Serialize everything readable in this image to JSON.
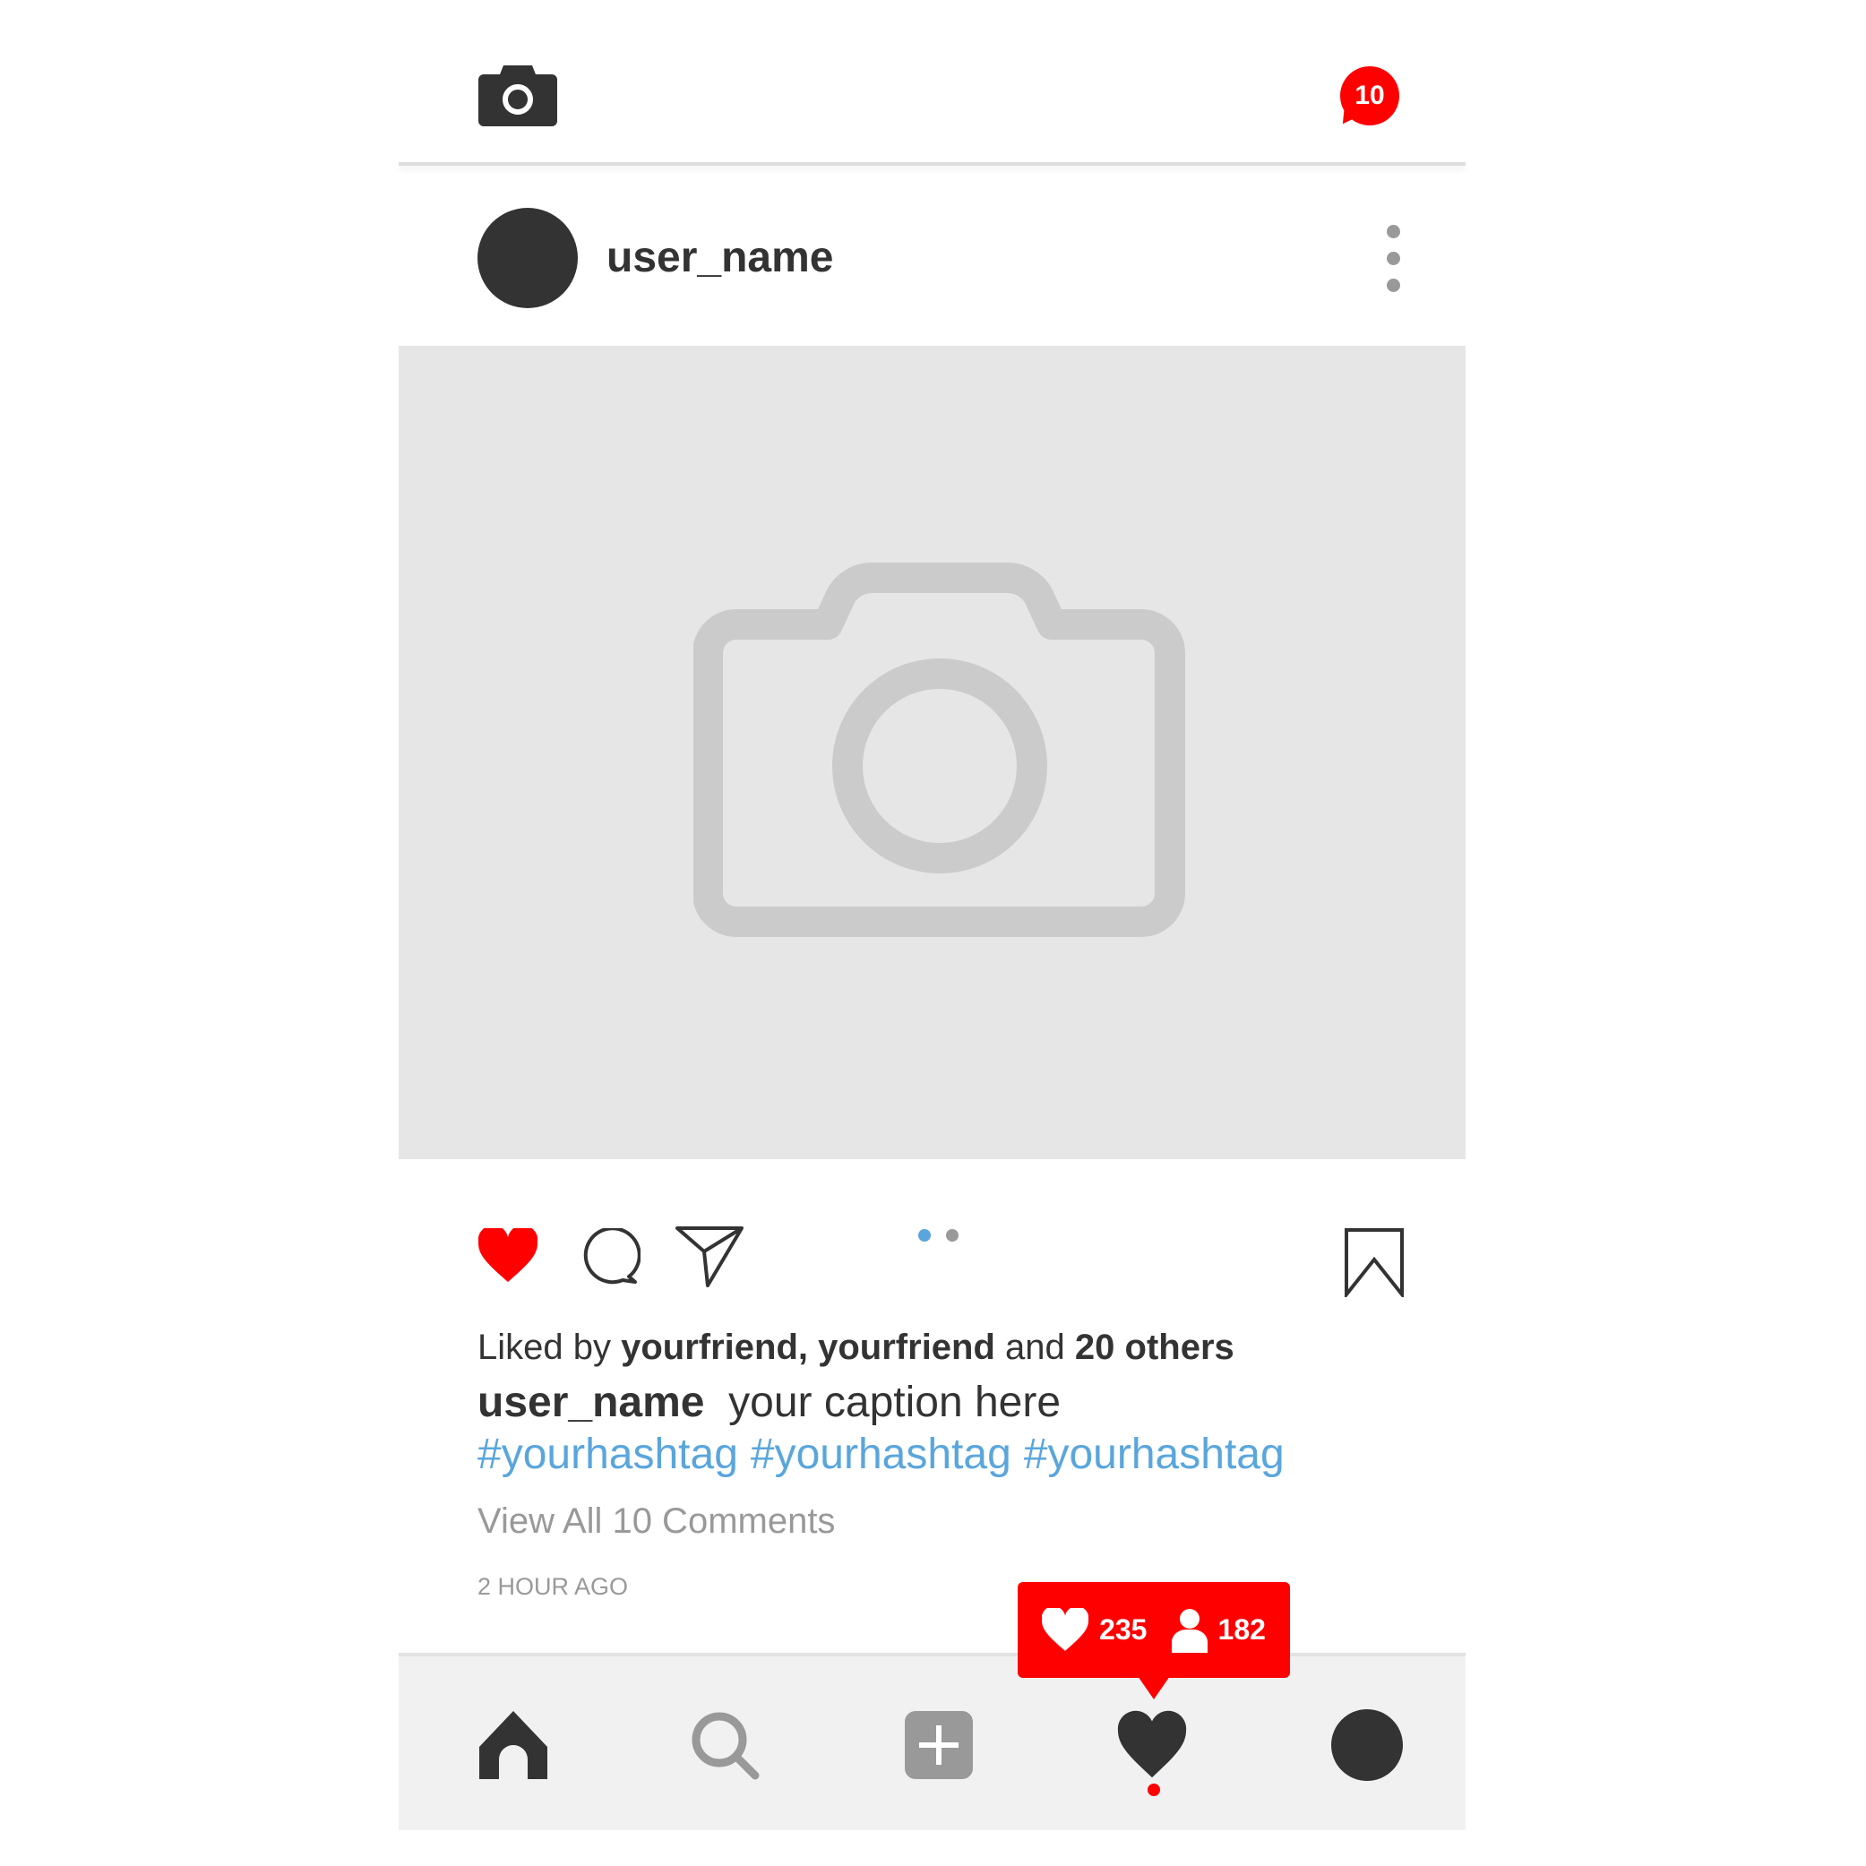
{
  "header": {
    "notification_count": "10",
    "icons": [
      "camera-icon",
      "notification-badge"
    ]
  },
  "post": {
    "username": "user_name",
    "more_icon": "vertical-dots-icon",
    "image_placeholder_icon": "camera-icon",
    "carousel": {
      "count": 2,
      "active": 1,
      "active_color": "#5aa6dc"
    },
    "actions": [
      "heart-icon",
      "comment-icon",
      "send-icon",
      "bookmark-icon"
    ],
    "liked_prefix": "Liked by",
    "liked_names": "yourfriend, yourfriend",
    "liked_and": "and",
    "liked_others": "20 others",
    "caption_user": "user_name",
    "caption": "your caption here",
    "hashtags": [
      "#yourhashtag",
      "#yourhashtag",
      "#yourhashtag"
    ],
    "view_comments": "View All 10 Comments",
    "timestamp": "2 HOUR AGO"
  },
  "activity_popup": {
    "likes": "235",
    "followers": "182"
  },
  "bottom_nav": [
    "home-icon",
    "search-icon",
    "add-icon",
    "activity-heart-icon",
    "profile-icon"
  ],
  "colors": {
    "accent_red": "#ff0000",
    "hashtag_blue": "#5aa6dc",
    "dark": "#333333",
    "placeholder": "#e6e6e6"
  }
}
